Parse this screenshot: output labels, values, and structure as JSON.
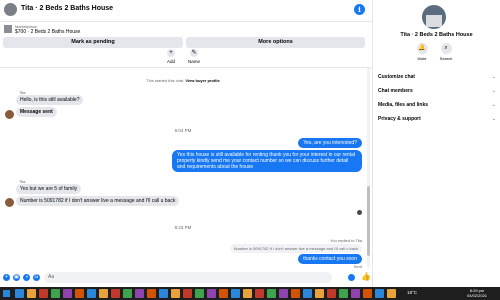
{
  "header": {
    "title": "Tita · 2 Beds 2 Baths House",
    "info_icon": "info-icon"
  },
  "listing": {
    "source": "Marketplace",
    "summary": "$700 · 2 Beds 2 Baths House"
  },
  "actions": {
    "mark_pending": "Mark as pending",
    "more_options": "More options",
    "add_label": "Add",
    "name_label": "Name"
  },
  "chat": {
    "started_note_prefix": "This started this chat.",
    "started_note_link": "View buyer profile",
    "sender_name_1": "Tita",
    "msg_in_1": "Hello, is this still available?",
    "msg_in_2": "Message sent",
    "time_1": "6:04 PM",
    "msg_out_1": "Yes, are you interested?",
    "msg_out_2": "Yes this house is still available for renting thank you for your interest in our rental property kindly send me your contact number so we can discuss further detail and requirements about the house",
    "sender_name_2": "Tita",
    "msg_in_3": "Yes but we are 5 of family",
    "msg_in_4": "Number is 5091782 if I don't answer live a message and I'll call u back",
    "time_2": "8:23 PM",
    "reply_note": "You replied to Tita",
    "reply_quote": "Number is 5091782 if I don't answer live a message and I'll call u back",
    "msg_out_3": "thanks contact you soon",
    "status": "Sent"
  },
  "composer": {
    "placeholder": "Aa"
  },
  "panel": {
    "title": "Tita · 2 Beds 2 Baths House",
    "mute_label": "Mute",
    "search_label": "Search",
    "items": [
      {
        "label": "Customize chat"
      },
      {
        "label": "Chat members"
      },
      {
        "label": "Media, files and links"
      },
      {
        "label": "Privacy & support"
      }
    ]
  },
  "taskbar": {
    "weather": "18°C",
    "time": "8:25 pm",
    "date": "04/02/2021"
  },
  "colors": {
    "accent": "#1877f2",
    "bubble_in": "#e4e6eb",
    "taskbar": "#1e1e1e"
  }
}
